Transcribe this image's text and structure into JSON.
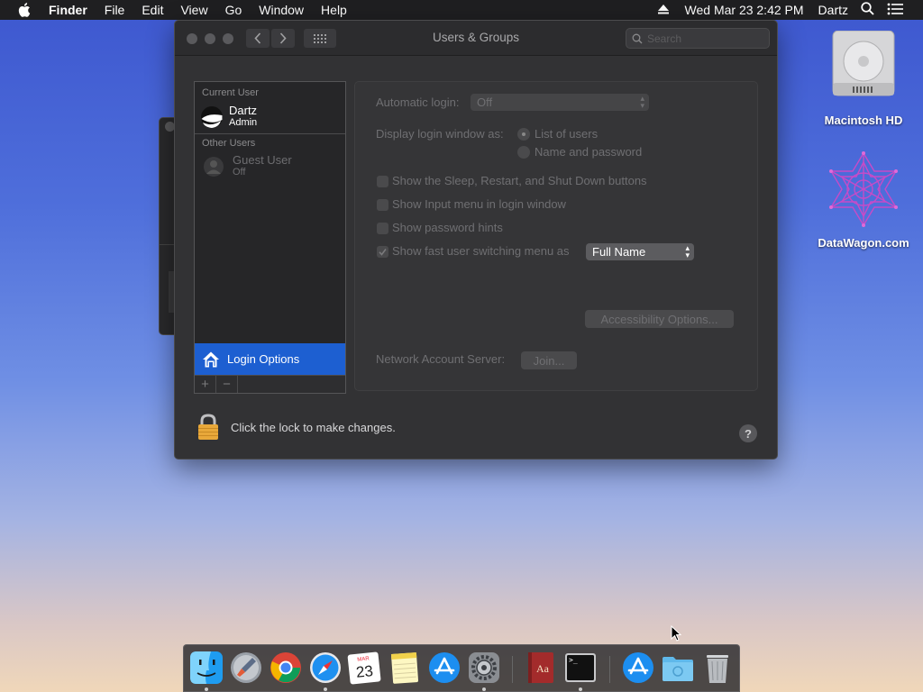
{
  "menubar": {
    "apple_icon": "apple-logo-icon",
    "app_name": "Finder",
    "items": [
      "File",
      "Edit",
      "View",
      "Go",
      "Window",
      "Help"
    ],
    "datetime": "Wed Mar 23  2:42 PM",
    "user": "Dartz"
  },
  "window": {
    "title": "Users & Groups",
    "search_placeholder": "Search",
    "sidebar": {
      "current_user_header": "Current User",
      "current_user": {
        "name": "Dartz",
        "role": "Admin"
      },
      "other_users_header": "Other Users",
      "guest_user": {
        "name": "Guest User",
        "status": "Off"
      },
      "login_options": "Login Options",
      "add_label": "+",
      "remove_label": "−"
    },
    "panel": {
      "automatic_login_label": "Automatic login:",
      "automatic_login_value": "Off",
      "display_login_label": "Display login window as:",
      "radio_list": "List of users",
      "radio_name": "Name and password",
      "selected_radio": "List of users",
      "chk_sleep": "Show the Sleep, Restart, and Shut Down buttons",
      "chk_input": "Show Input menu in login window",
      "chk_hints": "Show password hints",
      "chk_fast": "Show fast user switching menu as",
      "fast_checked": true,
      "fast_value": "Full Name",
      "accessibility_button": "Accessibility Options...",
      "network_label": "Network Account Server:",
      "join_button": "Join..."
    },
    "lock_text": "Click the lock to make changes.",
    "help_label": "?"
  },
  "desktop": {
    "icons": [
      {
        "label": "Macintosh HD",
        "icon": "hard-drive-icon"
      },
      {
        "label": "DataWagon.com",
        "icon": "datawagon-logo-icon"
      }
    ]
  },
  "dock": {
    "calendar_month": "MAR",
    "calendar_day": "23",
    "items": [
      "finder",
      "launchpad",
      "chrome",
      "safari",
      "calendar",
      "notes",
      "app-store",
      "system-preferences",
      "dictionary",
      "terminal",
      "app-store-download",
      "folder",
      "trash"
    ]
  },
  "colors": {
    "selection": "#1d5fd1",
    "window_bg": "#323234",
    "menubar_bg": "#1f1f21"
  }
}
